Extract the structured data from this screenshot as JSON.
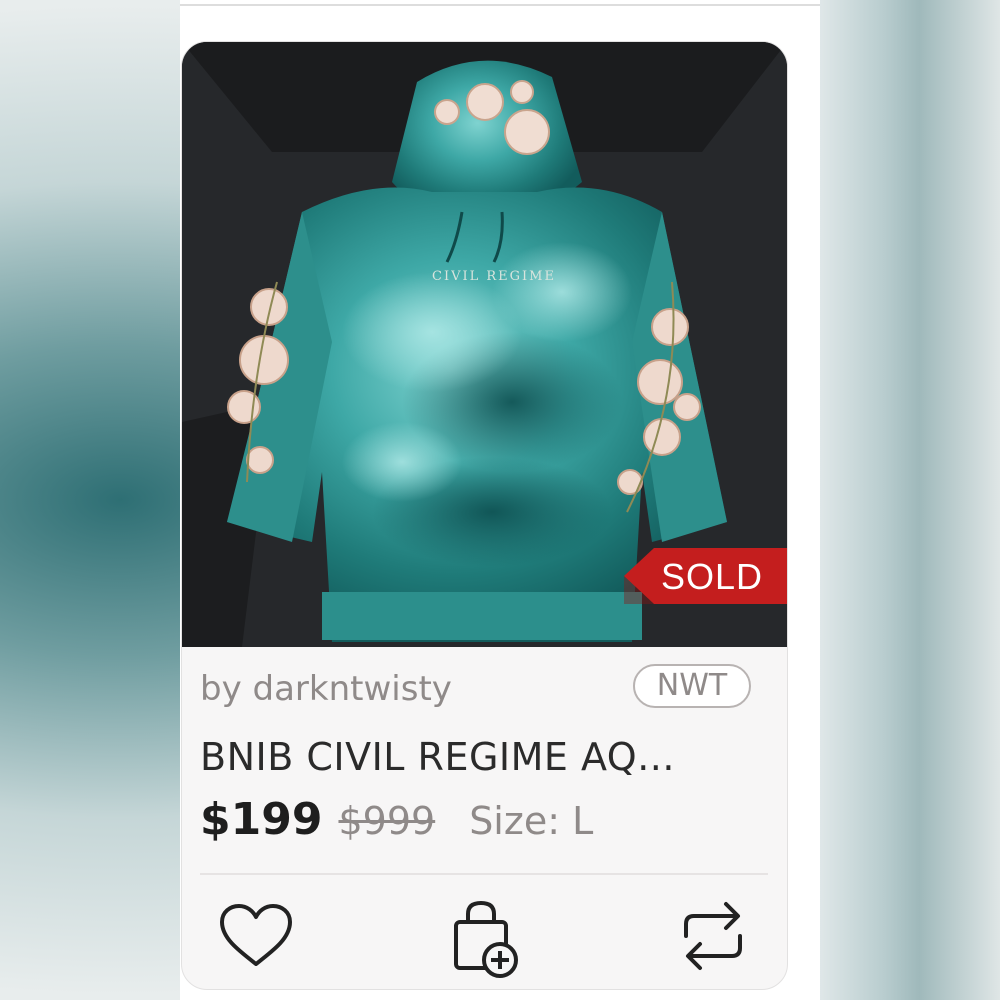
{
  "listing": {
    "status_badge": "SOLD",
    "seller": "by darkntwisty",
    "condition": "NWT",
    "title": "BNIB CIVIL REGIME AQ...",
    "price": "$199",
    "original_price": "$999",
    "size": "Size: L",
    "photo_print": "CIVIL REGIME"
  },
  "actions": {
    "like": "heart-icon",
    "add_to_bundle": "bag-plus-icon",
    "share": "repost-icon"
  },
  "colors": {
    "sold_ribbon": "#c41e1e",
    "price_text": "#1e1e1e",
    "muted_text": "#8f8a89",
    "card_bg": "#f7f6f6"
  }
}
